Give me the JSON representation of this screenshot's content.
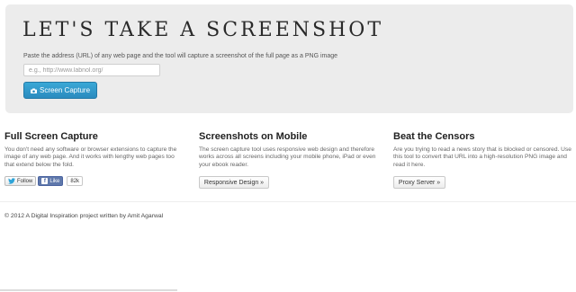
{
  "hero": {
    "title": "LET'S TAKE A SCREENSHOT",
    "description": "Paste the address (URL) of any web page and the tool will capture a screenshot of the full page as a PNG image",
    "url_value": "",
    "url_placeholder": "e.g., http://www.labnol.org/",
    "capture_label": "Screen Capture",
    "capture_icon": "camera-icon"
  },
  "features": [
    {
      "heading": "Full Screen Capture",
      "text": "You don't need any software or browser extensions to capture the image of any web page. And it works with lengthy web pages too that extend below the fold."
    },
    {
      "heading": "Screenshots on Mobile",
      "text": "The screen capture tool uses responsive web design and therefore works across all screens including your mobile phone, iPad or even your ebook reader.",
      "button_label": "Responsive Design »"
    },
    {
      "heading": "Beat the Censors",
      "text": "Are you trying to read a news story that is blocked or censored. Use this tool to convert that URL into a high-resolution PNG image and read it here.",
      "button_label": "Proxy Server »"
    }
  ],
  "social": {
    "follow_label": "Follow",
    "like_label": "Like",
    "like_count": "82k",
    "twitter_icon": "twitter-bird-icon",
    "facebook_icon": "facebook-icon"
  },
  "footer": {
    "text": "© 2012 A Digital Inspiration project written by Amit Agarwal"
  },
  "colors": {
    "hero_bg": "#ececec",
    "capture_button": "#2a8bbf",
    "facebook": "#5f78ab"
  }
}
